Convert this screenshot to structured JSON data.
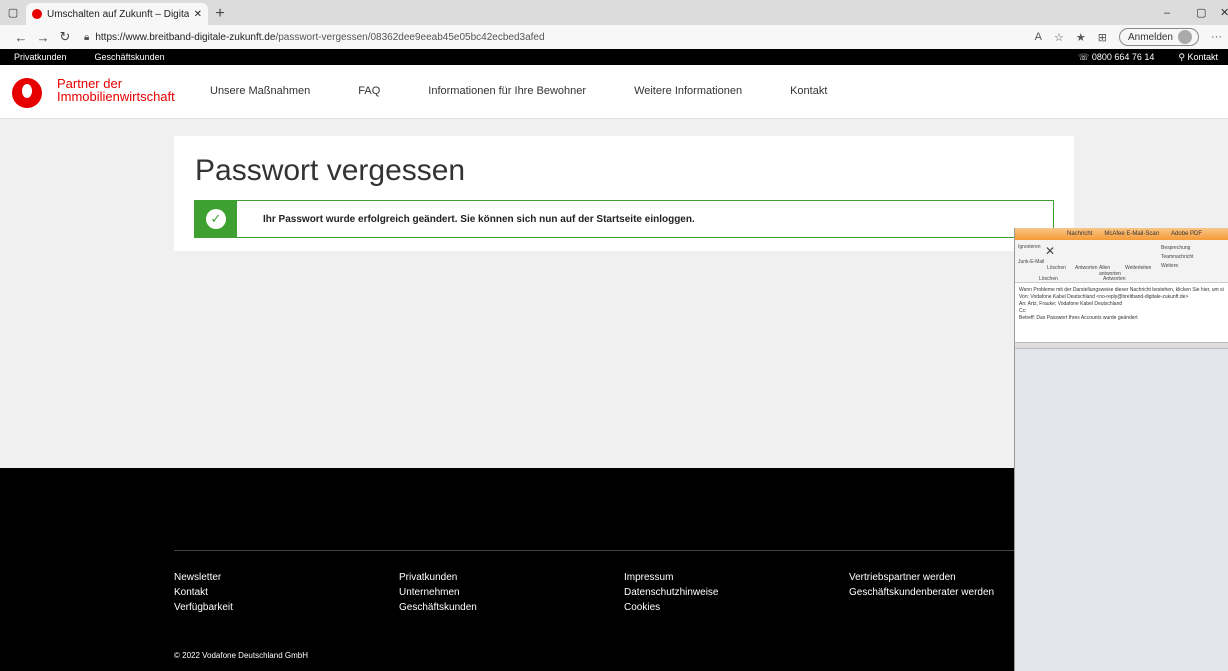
{
  "browser": {
    "tab_title": "Umschalten auf Zukunft – Digita",
    "url_domain": "https://www.breitband-digitale-zukunft.de",
    "url_path": "/passwort-vergessen/08362dee9eeab45e05bc42ecbed3afed",
    "signin_label": "Anmelden"
  },
  "topbar": {
    "items": [
      "Privatkunden",
      "Geschäftskunden"
    ],
    "phone": "0800 664 76 14",
    "contact": "Kontakt"
  },
  "brand": {
    "line1": "Partner der",
    "line2": "Immobilienwirtschaft"
  },
  "nav": [
    "Unsere Maßnahmen",
    "FAQ",
    "Informationen für Ihre Bewohner",
    "Weitere Informationen",
    "Kontakt"
  ],
  "card": {
    "title": "Passwort vergessen",
    "message": "Ihr Passwort wurde erfolgreich geändert. Sie können sich nun auf der Startseite einloggen."
  },
  "footer": {
    "columns": [
      [
        "Newsletter",
        "Kontakt",
        "Verfügbarkeit"
      ],
      [
        "Privatkunden",
        "Unternehmen",
        "Geschäftskunden"
      ],
      [
        "Impressum",
        "Datenschutzhinweise",
        "Cookies"
      ],
      [
        "Vertriebspartner werden",
        "Geschäftskundenberater werden"
      ]
    ],
    "copyright": "© 2022 Vodafone Deutschland GmbH"
  },
  "outlook": {
    "tabs": [
      "Nachricht",
      "McAfee E-Mail-Scan",
      "Adobe PDF"
    ],
    "actions": [
      "Ignorieren",
      "Löschen",
      "Antworten",
      "Allen antworten",
      "Weiterleiten",
      "Besprechung",
      "Teamnachricht",
      "Weitere",
      "Junk-E-Mail"
    ],
    "group_delete": "Löschen",
    "group_reply": "Antworten",
    "info": "Wenn Probleme mit der Darstellungsweise dieser Nachricht bestehen, klicken Sie hier, um sie im Webbrowser anzuzeigen.",
    "from_label": "Von:",
    "from": "Vodafone Kabel Deutschland <no-reply@breitband-digitale-zukunft.de>",
    "to_label": "An:",
    "to": "Artz, Frauke; Vodafone Kabel Deutschland",
    "cc_label": "Cc:",
    "subject_label": "Betreff:",
    "subject": "Das Passwort Ihres Accounts wurde geändert"
  }
}
